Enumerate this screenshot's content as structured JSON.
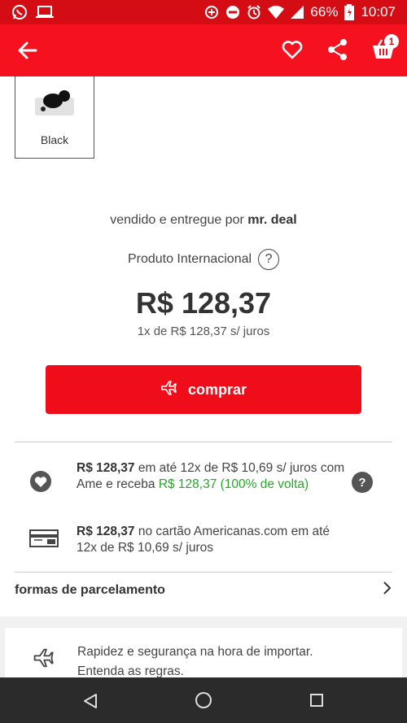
{
  "status_bar": {
    "battery": "66%",
    "time": "10:07"
  },
  "app_bar": {
    "cart_count": "1"
  },
  "variant": {
    "label": "Black"
  },
  "seller": {
    "prefix": "vendido e entregue por",
    "name": "mr. deal"
  },
  "product_origin": {
    "label": "Produto Internacional",
    "help": "?"
  },
  "pricing": {
    "price": "R$ 128,37",
    "installment": "1x de R$ 128,37 s/ juros"
  },
  "buy_button": {
    "label": "comprar"
  },
  "offers": [
    {
      "amount": "R$ 128,37",
      "text": "em até 12x de R$ 10,69 s/ juros com Ame e receba",
      "cashback": "R$ 128,37 (100% de volta)",
      "help": "?"
    },
    {
      "amount": "R$ 128,37",
      "text": "no cartão Americanas.com em até 12x de R$ 10,69 s/ juros"
    }
  ],
  "installment_link": {
    "label": "formas de parcelamento"
  },
  "import_info": {
    "line1": "Rapidez e segurança na hora de importar.",
    "line2": "Entenda as regras."
  }
}
